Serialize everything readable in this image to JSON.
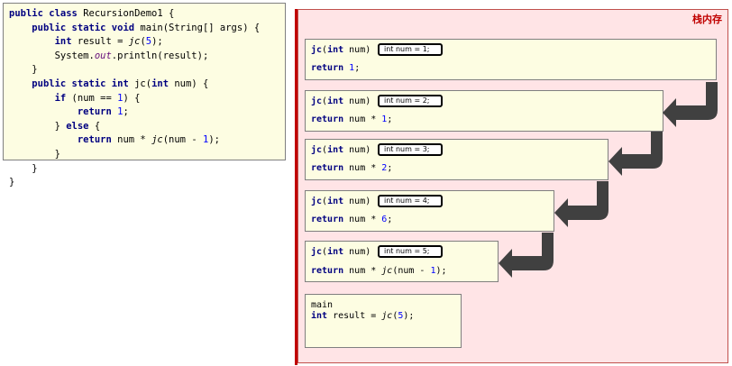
{
  "code": {
    "lines": [
      "public class RecursionDemo1 {",
      "    public static void main(String[] args) {",
      "        int result = jc(5);",
      "        System.out.println(result);",
      "    }",
      "    public static int jc(int num) {",
      "        if (num == 1) {",
      "            return 1;",
      "        } else {",
      "            return num * jc(num - 1);",
      "        }",
      "    }",
      "}"
    ]
  },
  "stack": {
    "title": "栈内存",
    "frames": [
      {
        "signature": "jc(int num)",
        "badge": "int num = 1;",
        "body": "return 1;"
      },
      {
        "signature": "jc(int num)",
        "badge": "int num = 2;",
        "body": "return num * 1;"
      },
      {
        "signature": "jc(int num)",
        "badge": "int num = 3;",
        "body": "return num * 2;"
      },
      {
        "signature": "jc(int num)",
        "badge": "int num = 4;",
        "body": "return num * 6;"
      },
      {
        "signature": "jc(int num)",
        "badge": "int num = 5;",
        "body": "return num * jc(num - 1);"
      }
    ],
    "main_frame": {
      "signature": "main",
      "body": "int result = jc(5);"
    }
  },
  "colors": {
    "stack_bg": "#ffe4e6",
    "stack_border": "#c00000",
    "frame_bg": "#fdfde2",
    "keyword": "#000080",
    "number": "#0000ff",
    "arrow": "#404040"
  }
}
